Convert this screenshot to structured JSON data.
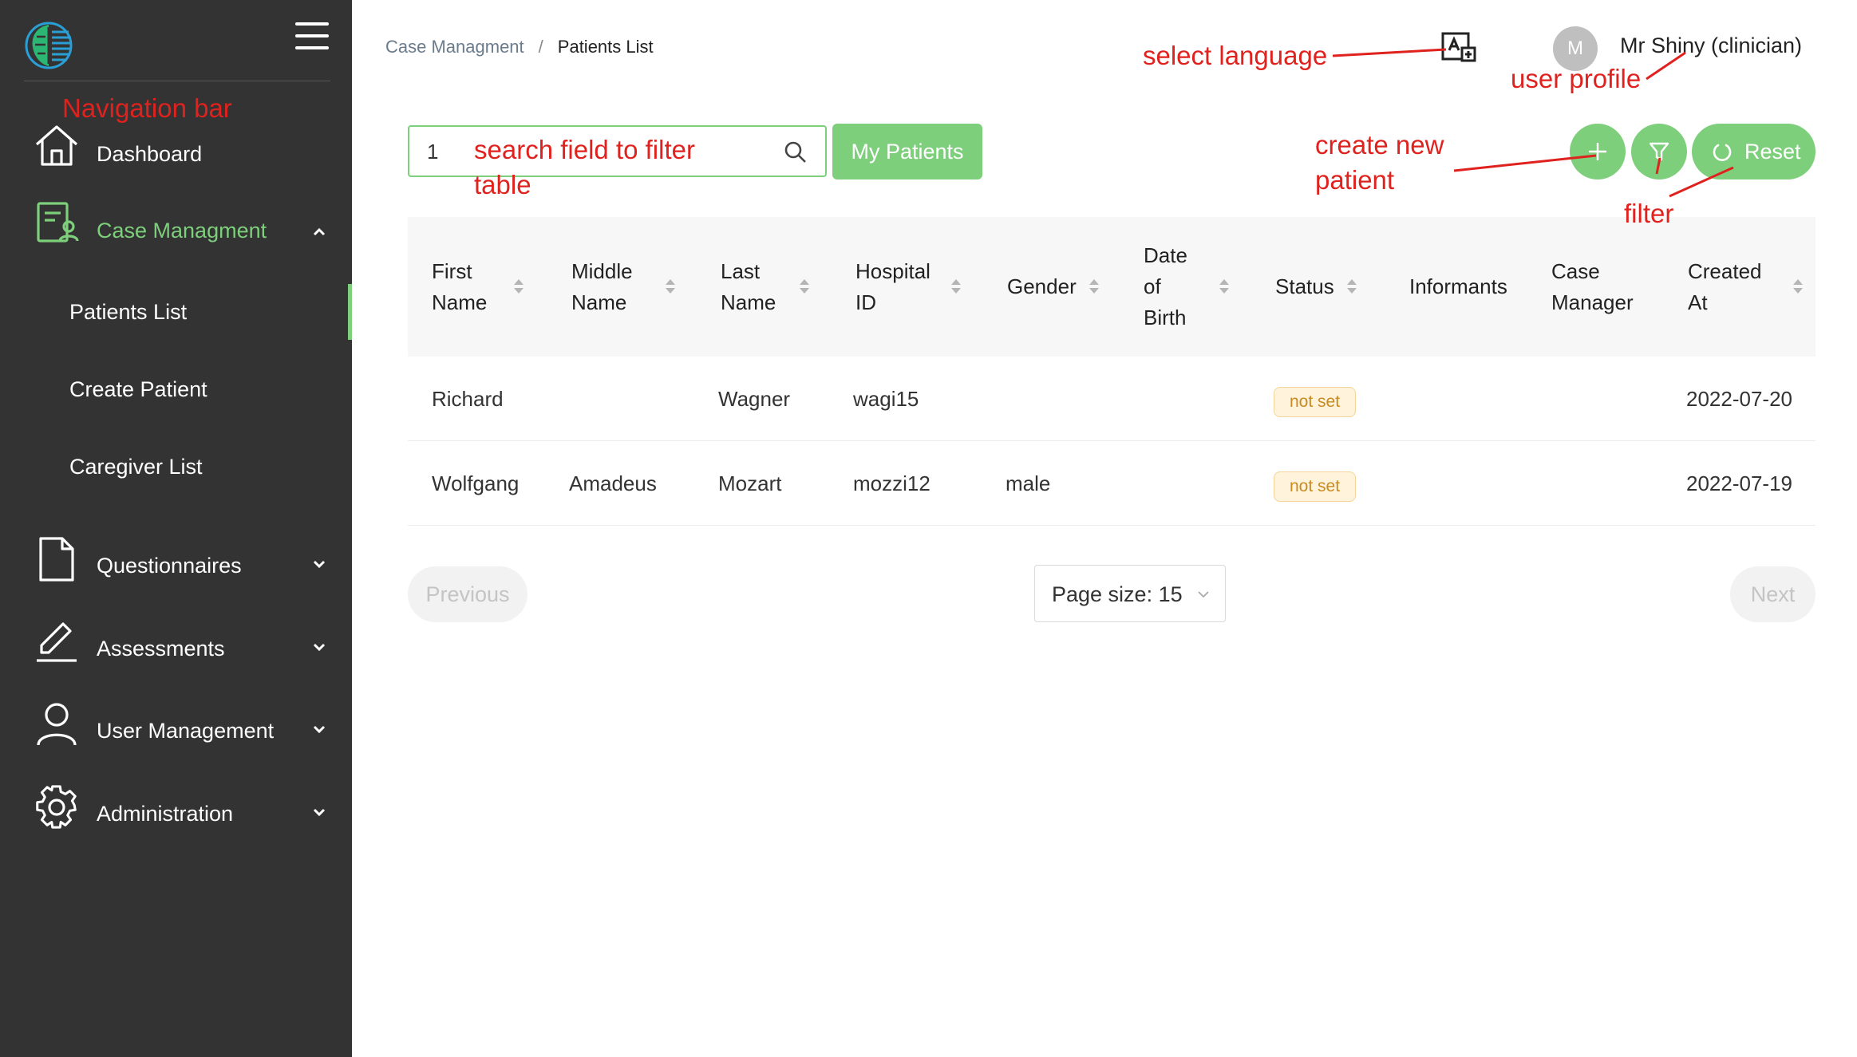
{
  "sidebar": {
    "items": [
      {
        "label": "Dashboard",
        "icon": "home-icon"
      },
      {
        "label": "Case Managment",
        "icon": "case-management-icon",
        "expanded": true
      },
      {
        "label": "Questionnaires",
        "icon": "document-icon"
      },
      {
        "label": "Assessments",
        "icon": "pen-icon"
      },
      {
        "label": "User Management",
        "icon": "user-icon"
      },
      {
        "label": "Administration",
        "icon": "gear-icon"
      }
    ],
    "sub_items": [
      {
        "label": "Patients List",
        "selected": true
      },
      {
        "label": "Create Patient"
      },
      {
        "label": "Caregiver List"
      }
    ]
  },
  "header": {
    "breadcrumb": {
      "parent": "Case Managment",
      "separator": "/",
      "current": "Patients List"
    },
    "avatar_initial": "M",
    "user_name": "Mr Shiny (clinician)"
  },
  "toolbar": {
    "search_value": "1",
    "my_patients_label": "My Patients",
    "reset_label": "Reset"
  },
  "table": {
    "columns": [
      {
        "label": "First Name",
        "sortable": true
      },
      {
        "label": "Middle Name",
        "sortable": true
      },
      {
        "label": "Last Name",
        "sortable": true
      },
      {
        "label": "Hospital ID",
        "sortable": true
      },
      {
        "label": "Gender",
        "sortable": true
      },
      {
        "label": "Date of Birth",
        "sortable": true
      },
      {
        "label": "Status",
        "sortable": true
      },
      {
        "label": "Informants",
        "sortable": false
      },
      {
        "label": "Case Manager",
        "sortable": false
      },
      {
        "label": "Created At",
        "sortable": true
      }
    ],
    "rows": [
      {
        "first": "Richard",
        "middle": "",
        "last": "Wagner",
        "hospital_id": "wagi15",
        "gender": "",
        "dob": "",
        "status": "not set",
        "informants": "",
        "case_manager": "",
        "created": "2022-07-20"
      },
      {
        "first": "Wolfgang",
        "middle": "Amadeus",
        "last": "Mozart",
        "hospital_id": "mozzi12",
        "gender": "male",
        "dob": "",
        "status": "not set",
        "informants": "",
        "case_manager": "",
        "created": "2022-07-19"
      }
    ]
  },
  "pagination": {
    "previous_label": "Previous",
    "next_label": "Next",
    "page_size_label": "Page size: 15"
  },
  "annotations": {
    "navigation_bar": "Navigation bar",
    "select_language": "select language",
    "user_profile": "user profile",
    "search_line1": "search field to filter",
    "search_line2": "table",
    "create_line1": "create new",
    "create_line2": "patient",
    "filter": "filter"
  },
  "colors": {
    "sidebar_bg": "#333333",
    "accent_green": "#7ecf7c",
    "annotation_red": "#e0221f",
    "badge_bg": "#fff3dc",
    "badge_text": "#c98a1f"
  }
}
